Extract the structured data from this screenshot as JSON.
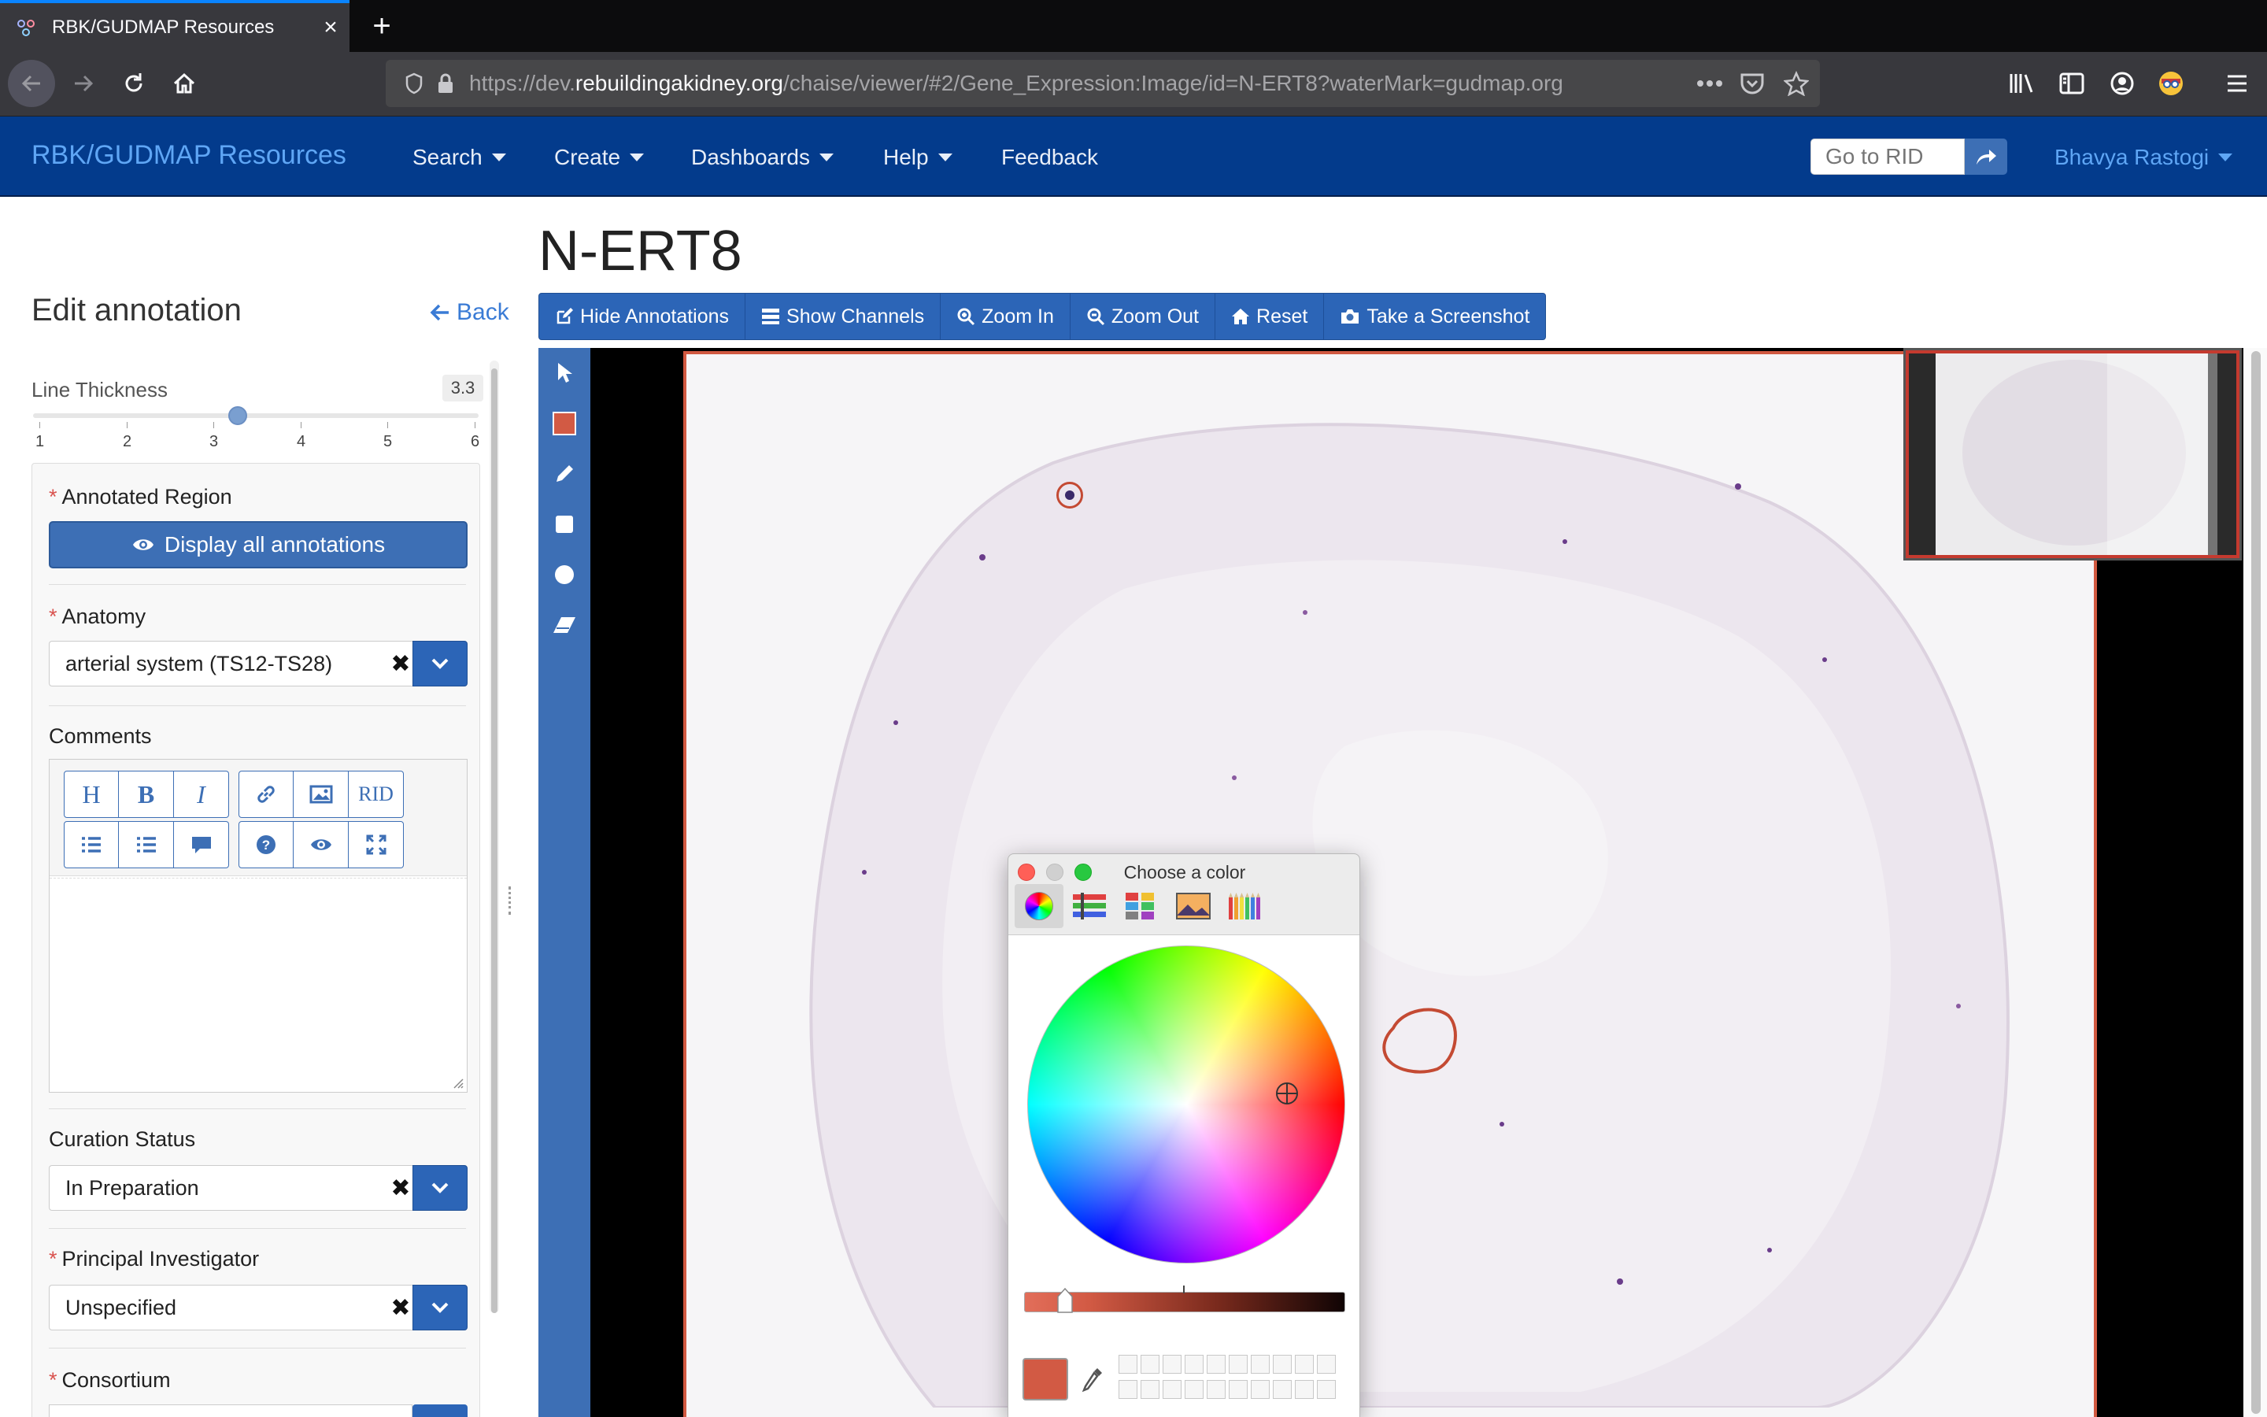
{
  "browser": {
    "tab_title": "RBK/GUDMAP Resources",
    "url_prefix": "https://dev.",
    "url_domain": "rebuildingakidney.org",
    "url_path": "/chaise/viewer/#2/Gene_Expression:Image/id=N-ERT8?waterMark=gudmap.org"
  },
  "appnav": {
    "brand": "RBK/GUDMAP Resources",
    "menus": [
      "Search",
      "Create",
      "Dashboards",
      "Help"
    ],
    "feedback": "Feedback",
    "rid_placeholder": "Go to RID",
    "user": "Bhavya Rastogi"
  },
  "sidebar": {
    "title": "Edit annotation",
    "back": "Back",
    "line_thickness_label": "Line Thickness",
    "line_thickness_value": "3.3",
    "line_thickness_fraction": 0.46,
    "ticks": [
      "1",
      "2",
      "3",
      "4",
      "5",
      "6"
    ],
    "annotated_region_label": "Annotated Region",
    "display_all_button": "Display all annotations",
    "anatomy_label": "Anatomy",
    "anatomy_value": "arterial system (TS12-TS28)",
    "comments_label": "Comments",
    "editor_buttons": [
      "H",
      "B",
      "I",
      "link",
      "image",
      "RID",
      "bulleted-list",
      "numbered-list",
      "comment",
      "help",
      "preview",
      "fullscreen"
    ],
    "rid_text": "RID",
    "curation_label": "Curation Status",
    "curation_value": "In Preparation",
    "pi_label": "Principal Investigator",
    "pi_value": "Unspecified",
    "consortium_label": "Consortium"
  },
  "main": {
    "title": "N-ERT8",
    "toolbar": [
      "Hide Annotations",
      "Show Channels",
      "Zoom In",
      "Zoom Out",
      "Reset",
      "Take a Screenshot"
    ]
  },
  "color_picker": {
    "title": "Choose a color",
    "modes": [
      "color-wheel",
      "color-sliders",
      "color-palettes",
      "image-palettes",
      "pencils"
    ],
    "selected_color": "#d25a44",
    "brightness_fraction": 0.1
  },
  "colors": {
    "appnav_bg": "#033b8c",
    "brand": "#5fa6f5",
    "primary_button": "#2c65b7",
    "annotation_stroke": "#c44a33"
  }
}
